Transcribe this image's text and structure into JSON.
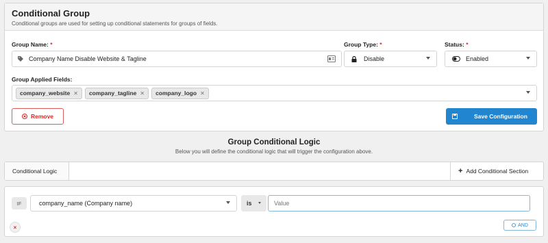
{
  "group": {
    "title": "Conditional Group",
    "description": "Conditional groups are used for setting up conditional statements for groups of fields.",
    "name_label": "Group Name:",
    "required_mark": "*",
    "name_value": "Company Name Disable Website & Tagline",
    "type_label": "Group Type:",
    "type_value": "Disable",
    "status_label": "Status:",
    "status_value": "Enabled",
    "applied_fields_label": "Group Applied Fields:",
    "applied_fields": [
      "company_website",
      "company_tagline",
      "company_logo"
    ],
    "remove_label": "Remove",
    "save_label": "Save Configuration"
  },
  "logic": {
    "title": "Group Conditional Logic",
    "description": "Below you will define the conditional logic that will trigger the configuration above.",
    "tab_label": "Conditional Logic",
    "add_section_label": "Add Conditional Section"
  },
  "condition": {
    "if_label": "IF",
    "field_value": "company_name (Company name)",
    "operator_value": "is",
    "value_placeholder": "Value",
    "and_label": "AND"
  },
  "colors": {
    "primary": "#2185d0",
    "danger": "#db2828"
  }
}
